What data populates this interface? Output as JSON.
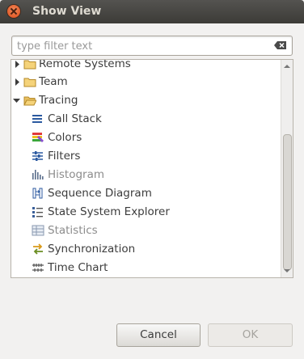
{
  "window": {
    "title": "Show View"
  },
  "filter": {
    "placeholder": "type filter text",
    "value": ""
  },
  "tree": {
    "items": [
      {
        "label": "Remote Systems",
        "type": "folder",
        "expanded": false
      },
      {
        "label": "Team",
        "type": "folder",
        "expanded": false
      },
      {
        "label": "Tracing",
        "type": "folder",
        "expanded": true
      },
      {
        "label": "Call Stack",
        "type": "view",
        "icon": "call-stack-icon",
        "enabled": true
      },
      {
        "label": "Colors",
        "type": "view",
        "icon": "colors-icon",
        "enabled": true
      },
      {
        "label": "Filters",
        "type": "view",
        "icon": "filters-icon",
        "enabled": true
      },
      {
        "label": "Histogram",
        "type": "view",
        "icon": "histogram-icon",
        "enabled": false
      },
      {
        "label": "Sequence Diagram",
        "type": "view",
        "icon": "sequence-diagram-icon",
        "enabled": true
      },
      {
        "label": "State System Explorer",
        "type": "view",
        "icon": "state-system-explorer-icon",
        "enabled": true
      },
      {
        "label": "Statistics",
        "type": "view",
        "icon": "statistics-icon",
        "enabled": false
      },
      {
        "label": "Synchronization",
        "type": "view",
        "icon": "synchronization-icon",
        "enabled": true
      },
      {
        "label": "Time Chart",
        "type": "view",
        "icon": "time-chart-icon",
        "enabled": true
      }
    ]
  },
  "buttons": {
    "cancel": "Cancel",
    "ok": "OK"
  },
  "colors": {
    "titlebar": "#3c3b37",
    "close": "#df4a16",
    "folder": "#e8b84a"
  }
}
